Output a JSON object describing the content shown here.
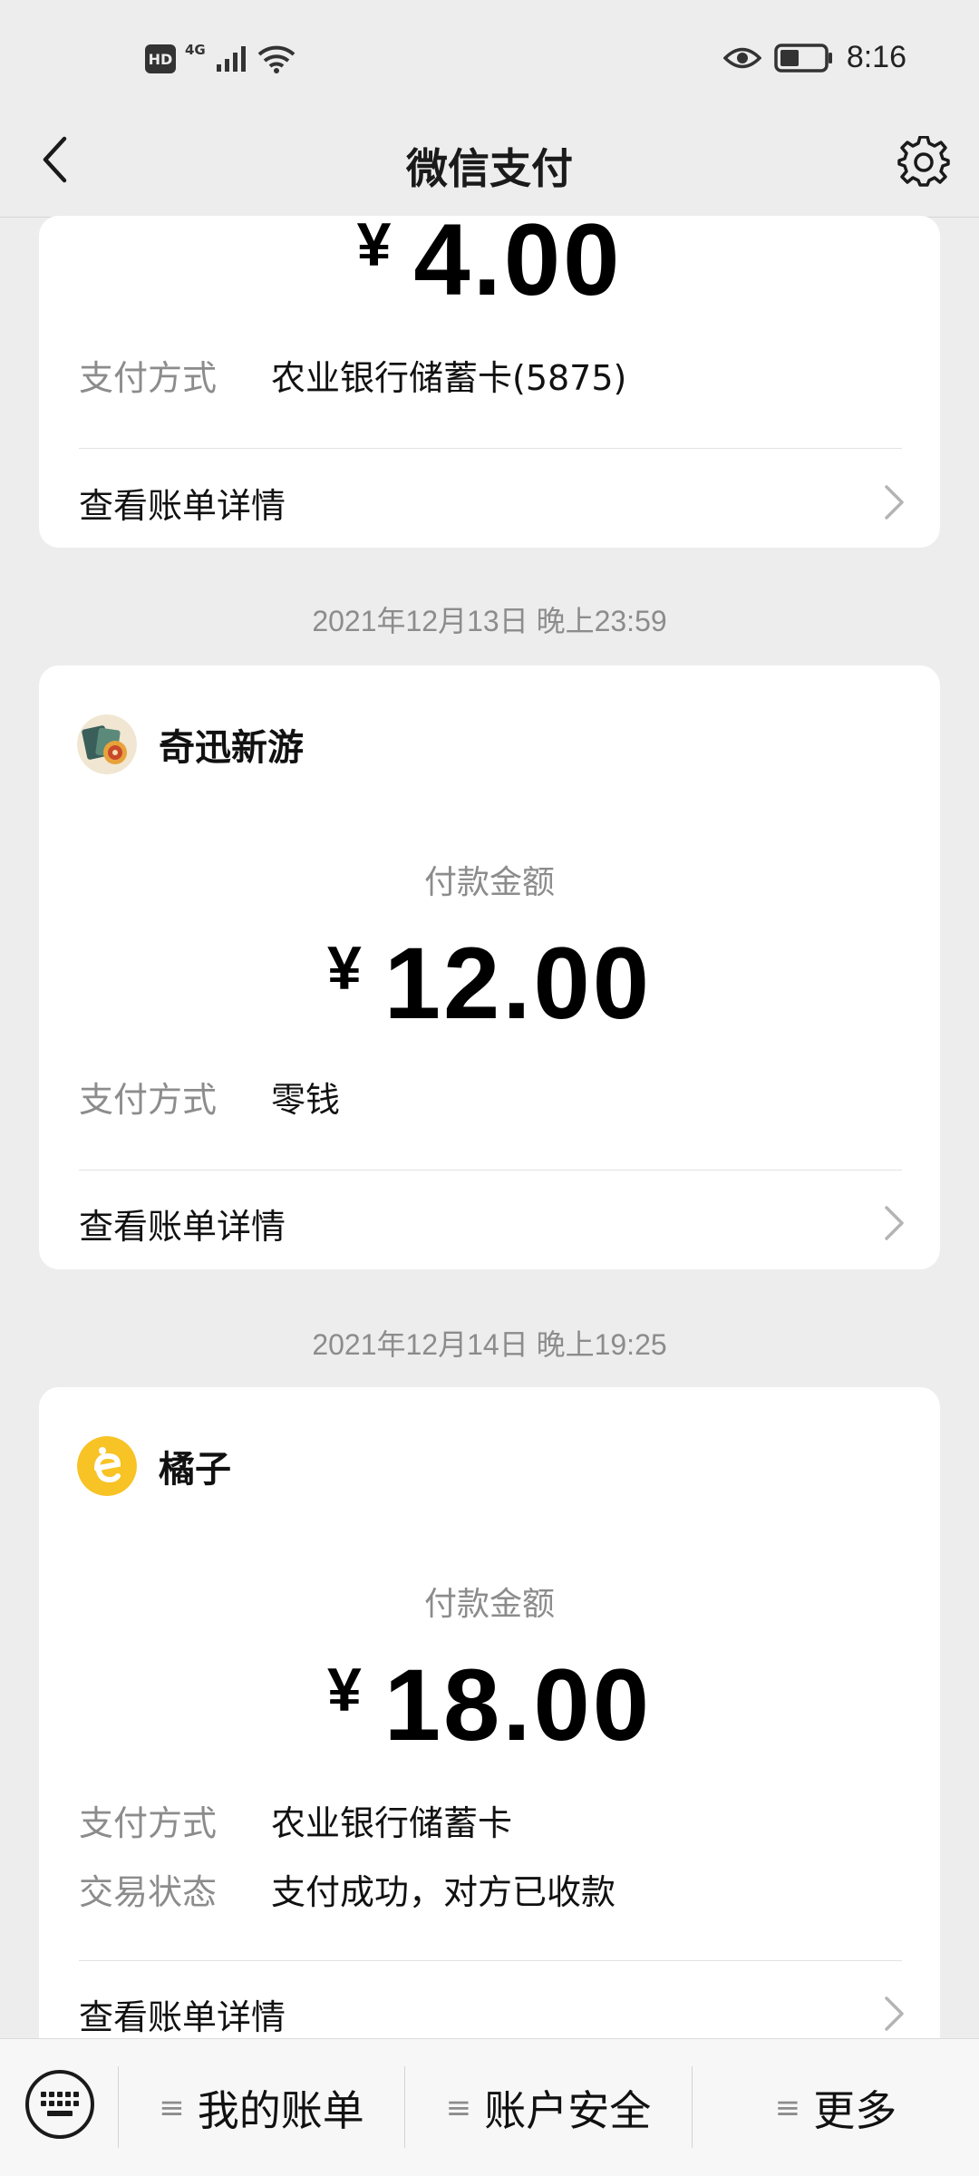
{
  "status_bar": {
    "hd_badge": "HD",
    "network": "4G",
    "time": "8:16",
    "icons": [
      "hd-icon",
      "cellular-signal-icon",
      "wifi-icon",
      "eye-icon",
      "battery-icon"
    ]
  },
  "nav": {
    "title": "微信支付",
    "back_icon": "back-arrow-icon",
    "settings_icon": "gear-icon"
  },
  "transactions": [
    {
      "currency": "¥",
      "amount": "4.00",
      "fields": [
        {
          "label": "支付方式",
          "value": "农业银行储蓄卡(5875)"
        }
      ],
      "detail_link": "查看账单详情"
    },
    {
      "timestamp": "2021年12月13日 晚上23:59",
      "merchant": "奇迅新游",
      "merchant_icon": "game-app-logo-icon",
      "amount_label": "付款金额",
      "currency": "¥",
      "amount": "12.00",
      "fields": [
        {
          "label": "支付方式",
          "value": "零钱"
        }
      ],
      "detail_link": "查看账单详情"
    },
    {
      "timestamp": "2021年12月14日 晚上19:25",
      "merchant": "橘子",
      "merchant_icon": "orange-app-logo-icon",
      "amount_label": "付款金额",
      "currency": "¥",
      "amount": "18.00",
      "fields": [
        {
          "label": "支付方式",
          "value": "农业银行储蓄卡"
        },
        {
          "label": "交易状态",
          "value": "支付成功，对方已收款"
        }
      ],
      "detail_link": "查看账单详情"
    }
  ],
  "bottom_bar": {
    "keyboard_icon": "keyboard-icon",
    "menu_mark": "≡",
    "items": [
      {
        "label": "我的账单"
      },
      {
        "label": "账户安全"
      },
      {
        "label": "更多"
      }
    ]
  },
  "colors": {
    "background": "#ededed",
    "card": "#ffffff",
    "muted_text": "#8c8c8c",
    "orange_logo": "#f7c325"
  }
}
